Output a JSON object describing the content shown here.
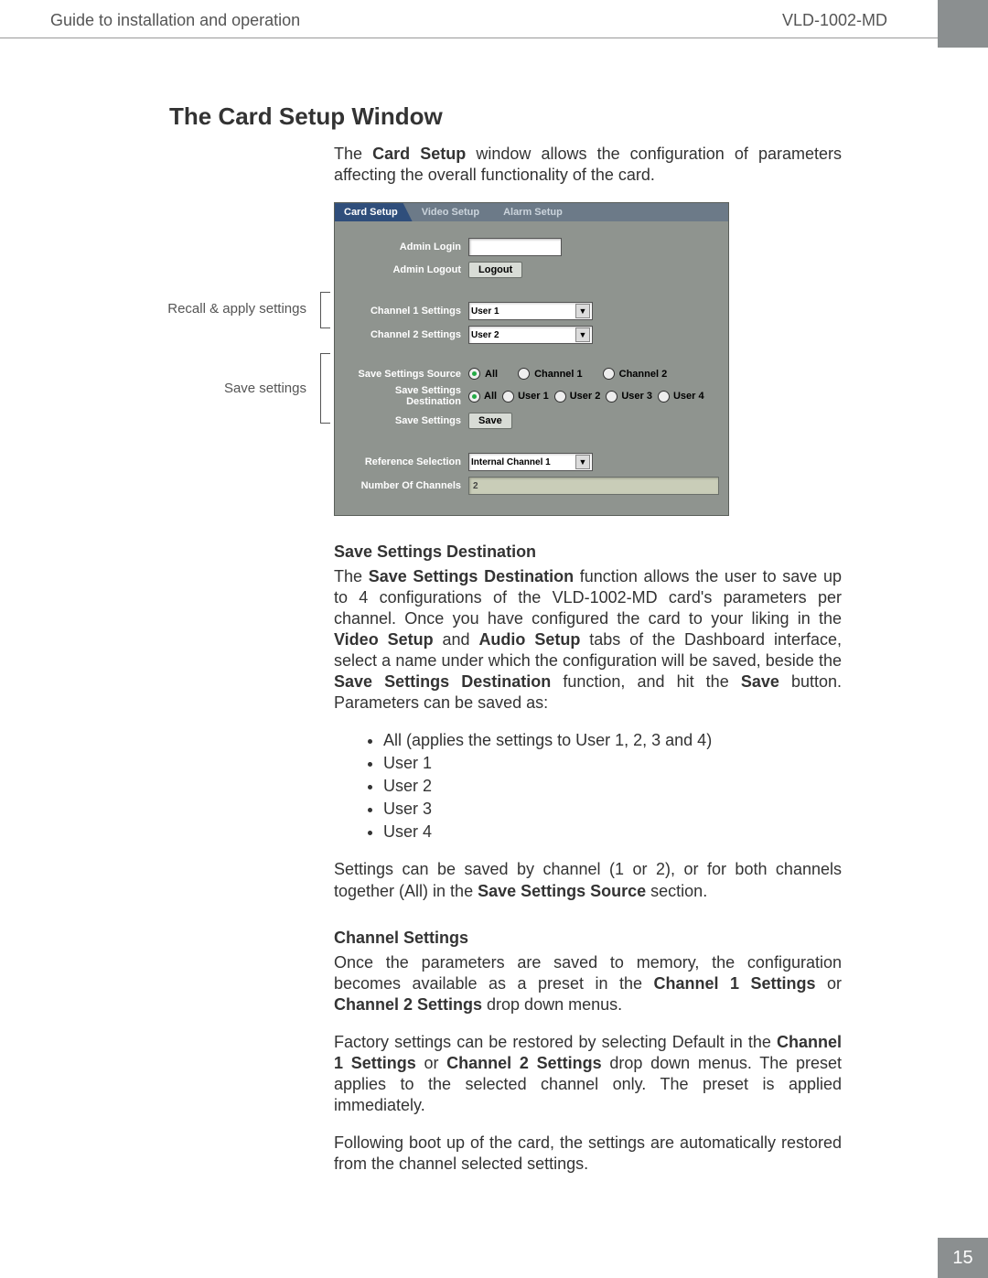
{
  "header": {
    "left": "Guide to installation and operation",
    "right": "VLD-1002-MD"
  },
  "page_number": "15",
  "title": "The Card Setup Window",
  "intro": "The Card Setup window allows the configuration of parameters affecting the overall functionality of the card.",
  "callouts": {
    "recall": "Recall & apply settings",
    "save": "Save settings"
  },
  "panel": {
    "tabs": [
      "Card Setup",
      "Video Setup",
      "Alarm Setup"
    ],
    "admin_login_label": "Admin Login",
    "admin_logout_label": "Admin Logout",
    "logout_button": "Logout",
    "ch1_settings_label": "Channel 1 Settings",
    "ch1_value": "User 1",
    "ch2_settings_label": "Channel 2 Settings",
    "ch2_value": "User 2",
    "save_source_label": "Save Settings Source",
    "source_options": [
      "All",
      "Channel 1",
      "Channel 2"
    ],
    "source_selected": "All",
    "save_dest_label": "Save Settings Destination",
    "dest_options": [
      "All",
      "User 1",
      "User 2",
      "User 3",
      "User 4"
    ],
    "dest_selected": "All",
    "save_settings_label": "Save Settings",
    "save_button": "Save",
    "ref_sel_label": "Reference Selection",
    "ref_sel_value": "Internal Channel 1",
    "num_ch_label": "Number Of Channels",
    "num_ch_value": "2"
  },
  "sections": {
    "ssd_title": "Save Settings Destination",
    "ssd_p1a": "The ",
    "ssd_b1": "Save Settings Destination",
    "ssd_p1b": " function allows the user to save up to 4 configurations of the VLD-1002-MD card's parameters per channel. Once you have configured the card to your liking in the ",
    "ssd_b2": "Video Setup",
    "ssd_p1c": " and ",
    "ssd_b3": "Audio Setup",
    "ssd_p1d": " tabs of the Dashboard interface, select a name under which the configuration will be saved, beside the ",
    "ssd_b4": "Save Settings Destination",
    "ssd_p1e": " function, and hit the ",
    "ssd_b5": "Save",
    "ssd_p1f": " button. Parameters can be saved as:",
    "options": [
      "All (applies the settings to User 1, 2, 3 and 4)",
      "User 1",
      "User 2",
      "User 3",
      "User 4"
    ],
    "ssd_p2a": "Settings can be saved by channel (1 or 2), or for both channels together (All) in the ",
    "ssd_b6": "Save Settings Source",
    "ssd_p2b": " section.",
    "cs_title": "Channel Settings",
    "cs_p1a": "Once the parameters are saved to memory, the configuration becomes available as a preset in the ",
    "cs_b1": "Channel 1 Settings",
    "cs_p1b": " or ",
    "cs_b2": "Channel 2 Settings",
    "cs_p1c": " drop down menus.",
    "cs_p2a": "Factory settings can be restored by selecting Default in the ",
    "cs_b3": "Channel 1 Settings",
    "cs_p2b": " or ",
    "cs_b4": "Channel 2 Settings",
    "cs_p2c": " drop down menus. The preset applies to the selected channel only. The preset is applied immediately.",
    "cs_p3": "Following boot up of the card, the settings are automatically restored from the channel selected settings."
  }
}
